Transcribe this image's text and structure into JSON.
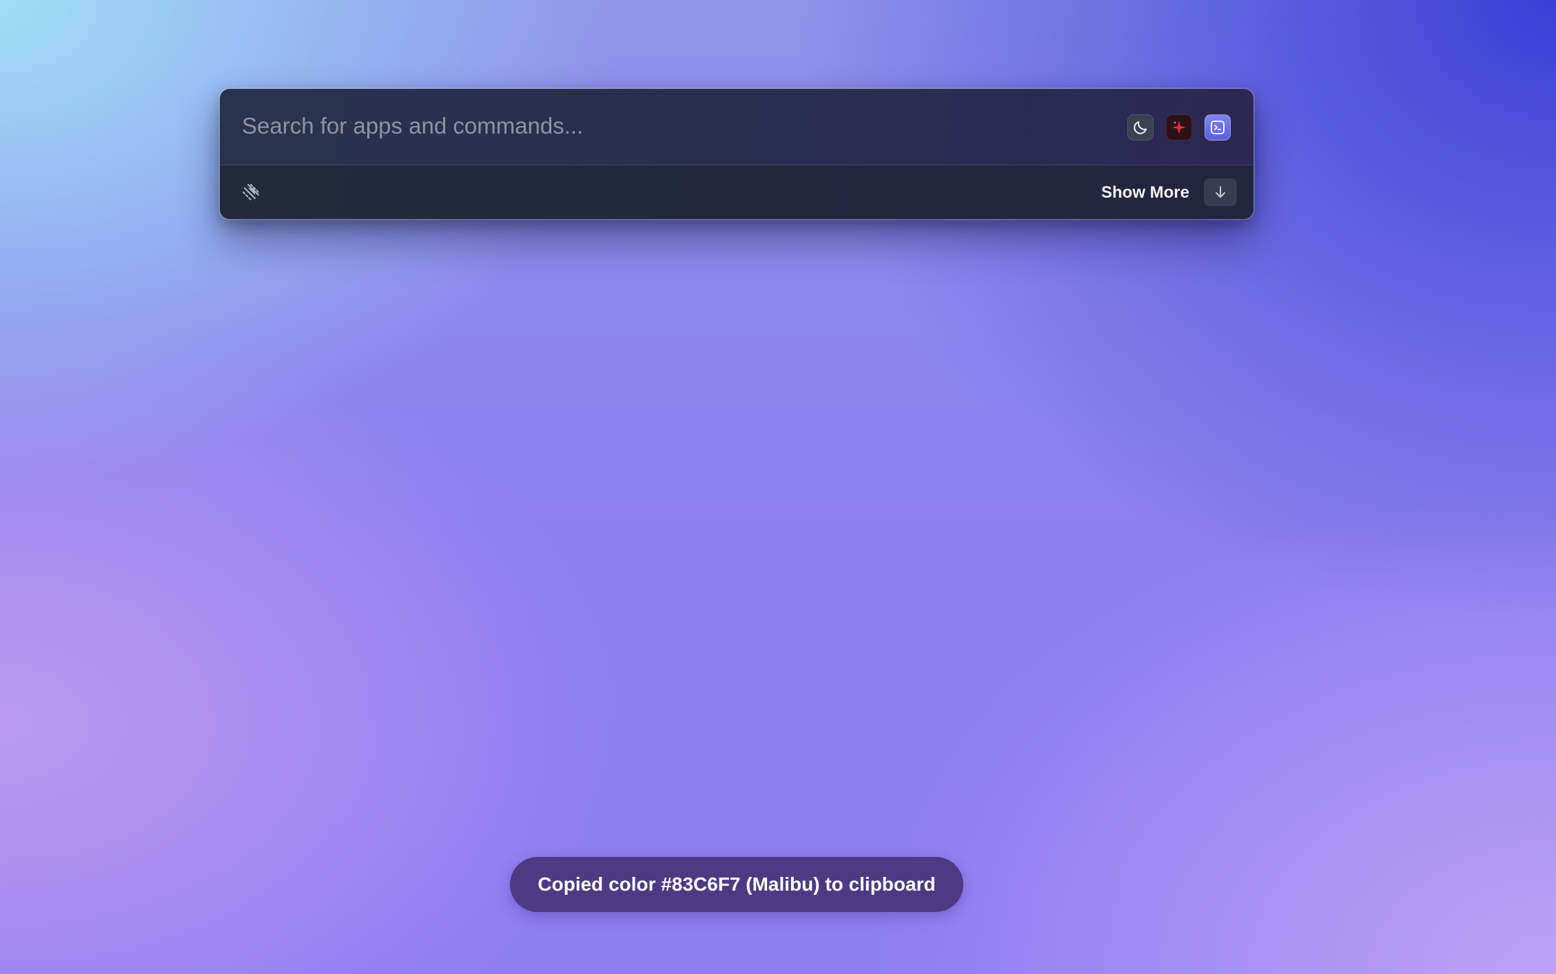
{
  "search": {
    "placeholder": "Search for apps and commands...",
    "value": ""
  },
  "menubar_extensions": [
    {
      "name": "moon-icon",
      "color": "#3b4150"
    },
    {
      "name": "sparkle-icon",
      "color": "#e8323c"
    },
    {
      "name": "terminal-icon",
      "color": "#6a70e8"
    }
  ],
  "action_bar": {
    "show_more_label": "Show More",
    "shortcut_icon": "arrow-down-icon"
  },
  "toast": {
    "message": "Copied color #83C6F7 (Malibu) to clipboard"
  },
  "colors": {
    "launcher_bg": "#262b48",
    "toast_bg": "#48347a",
    "accent": "#6a70e8"
  }
}
